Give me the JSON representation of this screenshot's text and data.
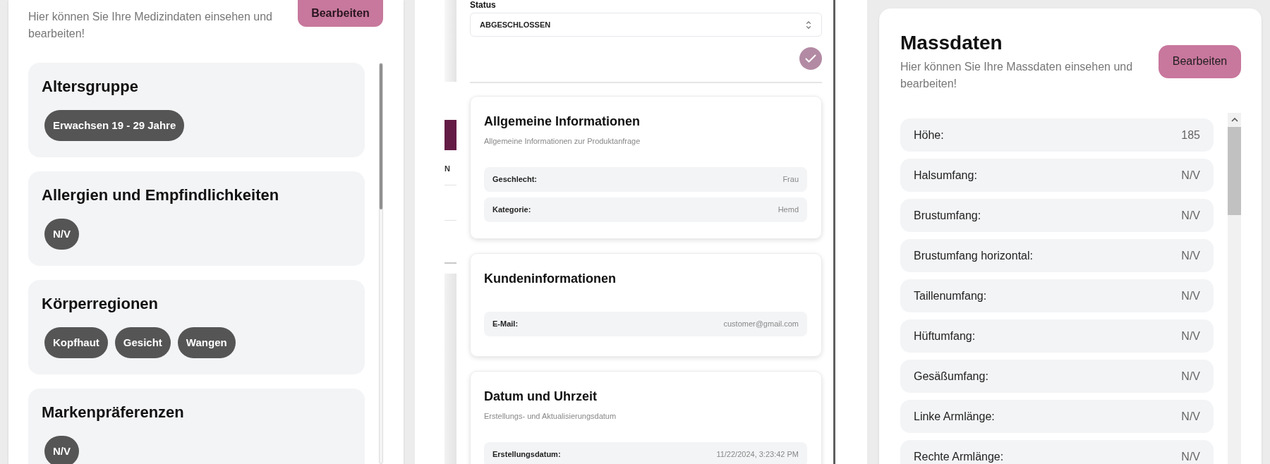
{
  "medical_data": {
    "description": "Hier können Sie Ihre Medizindaten einsehen und bearbeiten!",
    "edit_button": "Bearbeiten",
    "sections": [
      {
        "title": "Altersgruppe",
        "tags": [
          "Erwachsen 19 - 29 Jahre"
        ]
      },
      {
        "title": "Allergien und Empfindlichkeiten",
        "tags": [
          "N/V"
        ]
      },
      {
        "title": "Körperregionen",
        "tags": [
          "Kopfhaut",
          "Gesicht",
          "Wangen"
        ]
      },
      {
        "title": "Markenpräferenzen",
        "tags": [
          "N/V"
        ]
      }
    ]
  },
  "background_table": {
    "column_1": "N"
  },
  "order_panel": {
    "status": {
      "label": "Status",
      "value": "ABGESCHLOSSEN"
    },
    "cards": [
      {
        "title": "Allgemeine Informationen",
        "subtitle": "Allgemeine Informationen zur Produktanfrage",
        "fields": [
          {
            "label": "Geschlecht:",
            "value": "Frau"
          },
          {
            "label": "Kategorie:",
            "value": "Hemd"
          }
        ]
      },
      {
        "title": "Kundeninformationen",
        "fields": [
          {
            "label": "E-Mail:",
            "value": "customer@gmail.com"
          }
        ]
      },
      {
        "title": "Datum und Uhrzeit",
        "subtitle": "Erstellungs- und Aktualisierungsdatum",
        "fields": [
          {
            "label": "Erstellungsdatum:",
            "value": "11/22/2024, 3:23:42 PM"
          }
        ]
      }
    ]
  },
  "measurements": {
    "title": "Massdaten",
    "description": "Hier können Sie Ihre Massdaten einsehen und bearbeiten!",
    "edit_button": "Bearbeiten",
    "rows": [
      {
        "label": "Höhe:",
        "value": "185"
      },
      {
        "label": "Halsumfang:",
        "value": "N/V"
      },
      {
        "label": "Brustumfang:",
        "value": "N/V"
      },
      {
        "label": "Brustumfang horizontal:",
        "value": "N/V"
      },
      {
        "label": "Taillenumfang:",
        "value": "N/V"
      },
      {
        "label": "Hüftumfang:",
        "value": "N/V"
      },
      {
        "label": "Gesäßumfang:",
        "value": "N/V"
      },
      {
        "label": "Linke Armlänge:",
        "value": "N/V"
      },
      {
        "label": "Rechte Armlänge:",
        "value": "N/V"
      }
    ]
  }
}
